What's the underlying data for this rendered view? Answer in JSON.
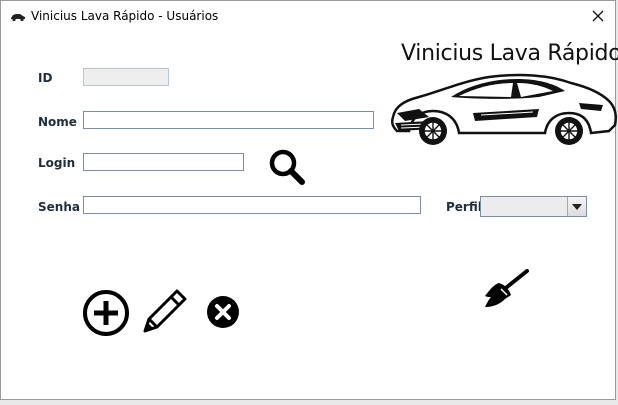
{
  "window": {
    "title": "Vinicius Lava Rápido - Usuários",
    "app_icon": "car-icon",
    "close_icon": "close-icon"
  },
  "brand": {
    "name": "Vinicius Lava Rápido",
    "logo": "sports-car-logo"
  },
  "form": {
    "id": {
      "label": "ID",
      "value": ""
    },
    "nome": {
      "label": "Nome",
      "value": ""
    },
    "login": {
      "label": "Login",
      "value": ""
    },
    "senha": {
      "label": "Senha",
      "value": ""
    },
    "perfil": {
      "label": "Perfil",
      "value": "",
      "options": []
    }
  },
  "actions": {
    "search": "search-icon",
    "create": "add-circle-icon",
    "edit": "pencil-icon",
    "delete": "delete-circle-icon",
    "clear": "broom-icon"
  },
  "colors": {
    "field_border": "#7a8ea6",
    "label_text": "#1f2d3d",
    "readonly_bg": "#eeeeee"
  }
}
